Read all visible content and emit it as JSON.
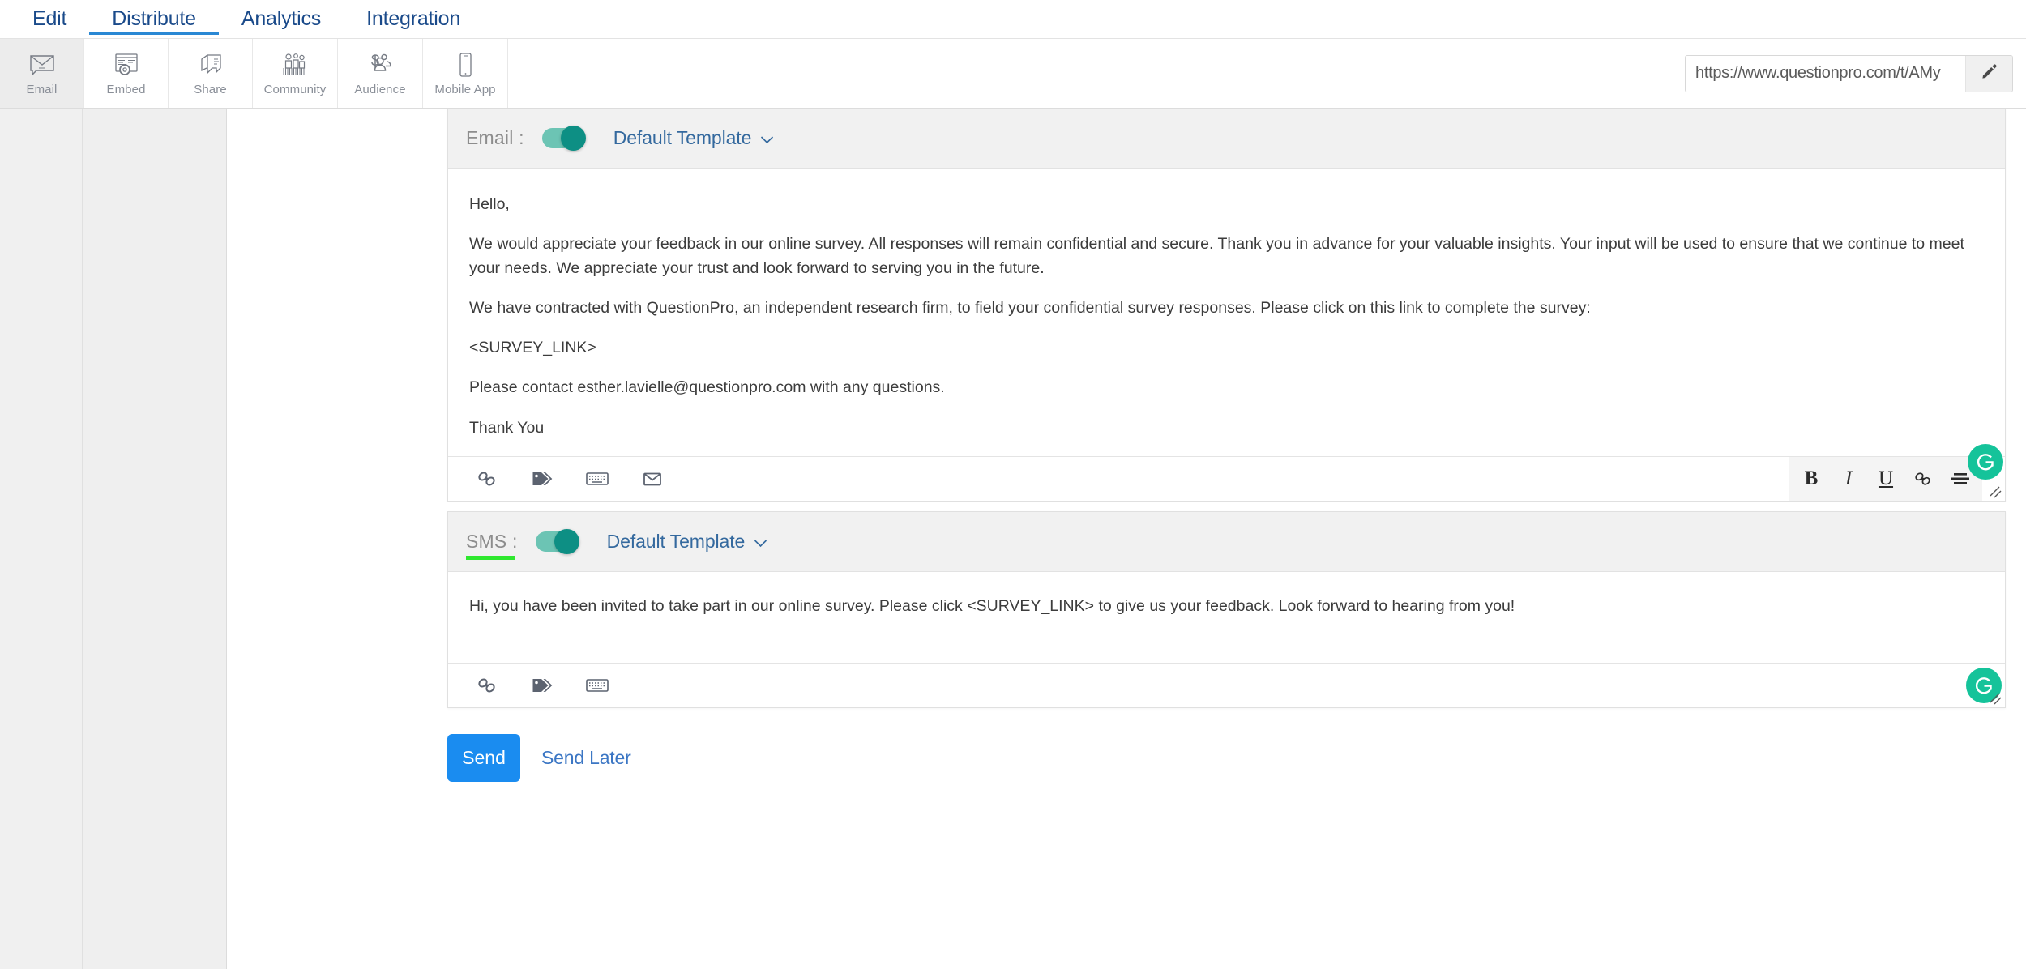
{
  "topnav": {
    "items": [
      {
        "label": "Edit",
        "active": false
      },
      {
        "label": "Distribute",
        "active": true
      },
      {
        "label": "Analytics",
        "active": false
      },
      {
        "label": "Integration",
        "active": false
      }
    ]
  },
  "channels": [
    {
      "label": "Email",
      "icon": "envelope-icon",
      "active": true
    },
    {
      "label": "Embed",
      "icon": "embed-window-gear-icon",
      "active": false
    },
    {
      "label": "Share",
      "icon": "share-speech-bubble-icon",
      "active": false
    },
    {
      "label": "Community",
      "icon": "community-people-icon",
      "active": false
    },
    {
      "label": "Audience",
      "icon": "audience-dollar-people-icon",
      "active": false
    },
    {
      "label": "Mobile App",
      "icon": "mobile-phone-icon",
      "active": false
    }
  ],
  "survey_url": {
    "value": "https://www.questionpro.com/t/AMy",
    "edit_icon": "pencil-icon"
  },
  "email_section": {
    "label": "Email :",
    "toggle_on": true,
    "template": "Default Template",
    "chevron": "chevron-down-icon",
    "body": [
      "Hello,",
      "We would appreciate your feedback in our online survey.  All responses will remain confidential and secure.  Thank you in advance for your valuable insights.  Your input will be used to ensure that we continue to meet your needs. We appreciate your trust and look forward to serving you in the future.",
      "We have contracted with QuestionPro, an independent research firm, to field your confidential survey responses.  Please click on this link to complete the survey:",
      "<SURVEY_LINK>",
      "Please contact esther.lavielle@questionpro.com with any questions.",
      "Thank You"
    ],
    "tools": [
      {
        "name": "link-icon"
      },
      {
        "name": "tag-icon"
      },
      {
        "name": "keyboard-icon"
      },
      {
        "name": "envelope-icon"
      }
    ],
    "format_tools": [
      {
        "name": "bold-button",
        "label": "B"
      },
      {
        "name": "italic-button",
        "label": "I"
      },
      {
        "name": "underline-button",
        "label": "U"
      },
      {
        "name": "insert-link-button",
        "label": ""
      },
      {
        "name": "align-button",
        "label": ""
      }
    ],
    "grammarly_icon": "grammarly-icon"
  },
  "sms_section": {
    "label": "SMS :",
    "toggle_on": true,
    "template": "Default Template",
    "chevron": "chevron-down-icon",
    "body": [
      "Hi, you have been invited to take part in our online survey. Please click <SURVEY_LINK> to give us your feedback. Look forward to hearing from you!"
    ],
    "tools": [
      {
        "name": "link-icon"
      },
      {
        "name": "tag-icon"
      },
      {
        "name": "keyboard-icon"
      }
    ],
    "grammarly_icon": "grammarly-icon"
  },
  "footer": {
    "send_label": "Send",
    "send_later_label": "Send Later"
  },
  "colors": {
    "nav_blue": "#1a4a8a",
    "tab_underline": "#2a88d4",
    "toggle_on": "#0d8f84",
    "toggle_track": "#6cc4b4",
    "link_blue": "#34699e",
    "send_button": "#1a8cf0",
    "grammarly_green": "#15c39a",
    "sms_highlight": "#2fe82f"
  }
}
